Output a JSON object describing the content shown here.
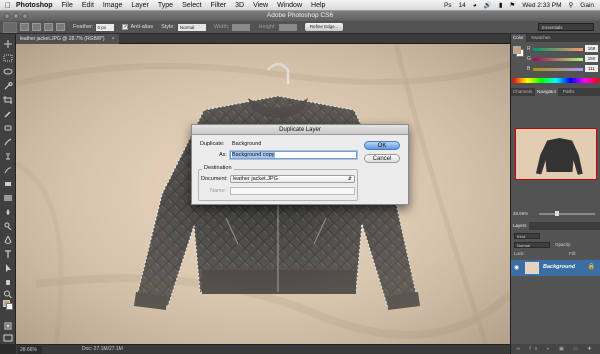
{
  "menubar": {
    "apple_icon": "apple-icon",
    "app_name": "Photoshop",
    "items": [
      "File",
      "Edit",
      "Image",
      "Layer",
      "Type",
      "Select",
      "Filter",
      "3D",
      "View",
      "Window",
      "Help"
    ],
    "status": {
      "ps_badge": "Ps",
      "battery_num": "14",
      "clock": "Wed 2:33 PM",
      "user": "Gain"
    }
  },
  "window": {
    "title": "Adobe Photoshop CS6"
  },
  "options_bar": {
    "feather_label": "Feather:",
    "feather_value": "0 px",
    "antialias_check": "✓",
    "antialias_label": "Anti-alias",
    "style_label": "Style:",
    "style_value": "Normal",
    "width_label": "Width:",
    "height_label": "Height:",
    "refine_label": "Refine Edge...",
    "workspace": "Essentials"
  },
  "document": {
    "tab_label": "leather jacket.JPG @ 28.7% (RGB/8*)",
    "close": "×",
    "zoom": "28.66%",
    "doc_size": "Doc: 27.1M/27.1M"
  },
  "color_panel": {
    "tabs": [
      "Color",
      "Swatches"
    ],
    "channels": [
      {
        "label": "R",
        "value": "168"
      },
      {
        "label": "G",
        "value": "150"
      },
      {
        "label": "B",
        "value": "111"
      }
    ],
    "fg_color": "#c9a27e"
  },
  "navigator_panel": {
    "tabs": [
      "Channels",
      "Navigator",
      "Paths"
    ],
    "zoom": "28.66%"
  },
  "layers_panel": {
    "title": "Layers",
    "kind": "Kind",
    "blend_mode": "Normal",
    "opacity_label": "Opacity:",
    "lock_label": "Lock:",
    "fill_label": "Fill:",
    "layer_name": "Background",
    "footer_icons": "∞ fx ◐ ▣ ▭ ✚ 🗑"
  },
  "dialog": {
    "title": "Duplicate Layer",
    "duplicate_label": "Duplicate:",
    "duplicate_value": "Background",
    "as_label": "As:",
    "as_value": "Background copy",
    "destination_label": "Destination",
    "document_label": "Document:",
    "document_value": "leather jacket.JPG",
    "name_label": "Name:",
    "ok_label": "OK",
    "cancel_label": "Cancel"
  }
}
